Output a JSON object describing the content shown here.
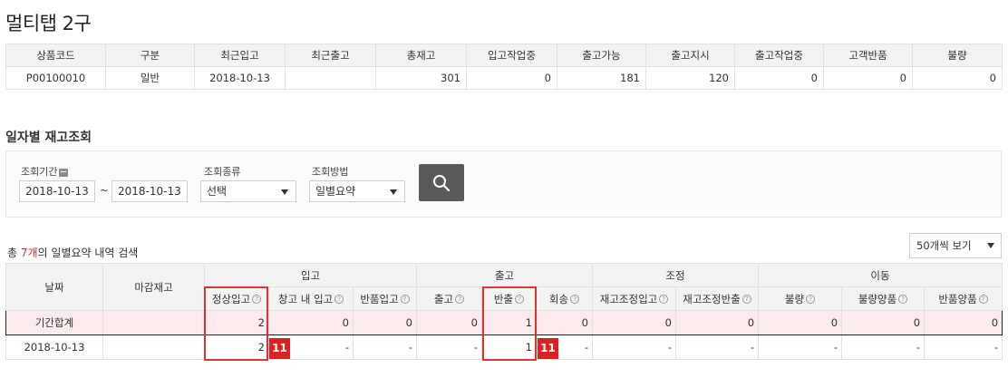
{
  "page": {
    "title": "멀티탭 2구"
  },
  "summary": {
    "headers": [
      "상품코드",
      "구분",
      "최근입고",
      "최근출고",
      "총재고",
      "입고작업중",
      "출고가능",
      "출고지시",
      "출고작업중",
      "고객반품",
      "불량"
    ],
    "row": [
      "P00100010",
      "일반",
      "2018-10-13",
      "",
      "301",
      "0",
      "181",
      "120",
      "0",
      "0",
      "0"
    ]
  },
  "section": {
    "title": "일자별 재고조회"
  },
  "search": {
    "period_label": "조회기간",
    "date_from": "2018-10-13",
    "tilde": "~",
    "date_to": "2018-10-13",
    "type_label": "조회종류",
    "type_value": "선택",
    "method_label": "조회방법",
    "method_value": "일별요약",
    "button_icon": "search-icon"
  },
  "result": {
    "prefix": "총 ",
    "count": "7개",
    "suffix": "의 일별요약 내역 검색",
    "page_size": "50개씩 보기"
  },
  "grid": {
    "col_date": "날짜",
    "col_close": "마감재고",
    "groups": [
      "입고",
      "출고",
      "조정",
      "이동"
    ],
    "sub": [
      "정상입고",
      "창고 내 입고",
      "반품입고",
      "출고",
      "반출",
      "회송",
      "재고조정입고",
      "재고조정반출",
      "불량",
      "불량양품",
      "반품양품"
    ],
    "total_row": [
      "기간합계",
      "",
      "2",
      "0",
      "0",
      "0",
      "1",
      "0",
      "0",
      "0",
      "0",
      "0",
      "0"
    ],
    "data_row": [
      "2018-10-13",
      "",
      "2",
      "-",
      "-",
      "-",
      "1",
      "-",
      "-",
      "-",
      "-",
      "-",
      "-"
    ],
    "badges": [
      "11",
      "11"
    ]
  }
}
